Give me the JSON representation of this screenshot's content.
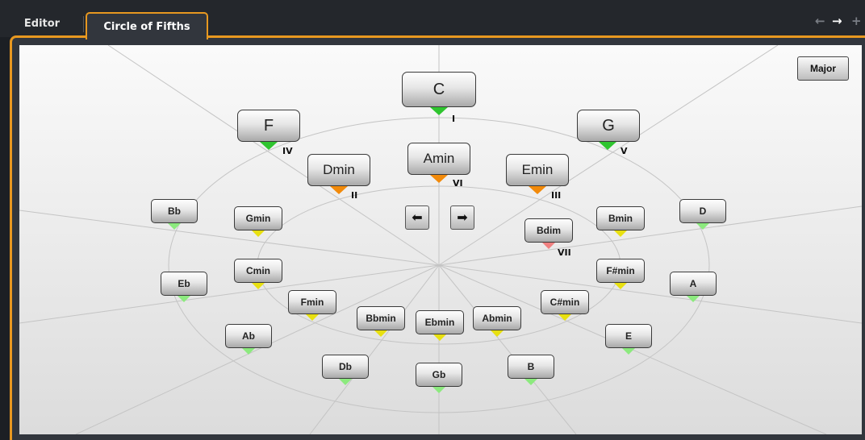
{
  "tabs": {
    "editor": "Editor",
    "circle_of_fifths": "Circle of Fifths"
  },
  "nav": {
    "back_icon": "arrow-left-icon",
    "forward_icon": "arrow-right-icon",
    "add_icon": "plus-icon"
  },
  "mode_button": "Major",
  "rotate": {
    "left_icon": "arrow-left-icon",
    "right_icon": "arrow-right-icon"
  },
  "colors": {
    "accent": "#e89820",
    "tonic": "#2fc52f",
    "secondary": "#f28a0a",
    "minor": "#e8e010",
    "outer": "#8cea7e",
    "diminished": "#f08080"
  },
  "chords": {
    "C": "C",
    "F": "F",
    "G": "G",
    "Dmin": "Dmin",
    "Amin": "Amin",
    "Emin": "Emin",
    "Bb": "Bb",
    "Gmin": "Gmin",
    "Bmin": "Bmin",
    "D": "D",
    "Bdim": "Bdim",
    "Cmin": "Cmin",
    "Fsmin": "F#min",
    "Eb": "Eb",
    "A": "A",
    "Fmin": "Fmin",
    "Csmin": "C#min",
    "Bbmin": "Bbmin",
    "Ebmin": "Ebmin",
    "Abmin": "Abmin",
    "Ab": "Ab",
    "E": "E",
    "Db": "Db",
    "Gb": "Gb",
    "B": "B"
  },
  "degrees": {
    "I": "I",
    "IV": "IV",
    "V": "V",
    "II": "II",
    "VI": "VI",
    "III": "III",
    "VII": "VII"
  }
}
